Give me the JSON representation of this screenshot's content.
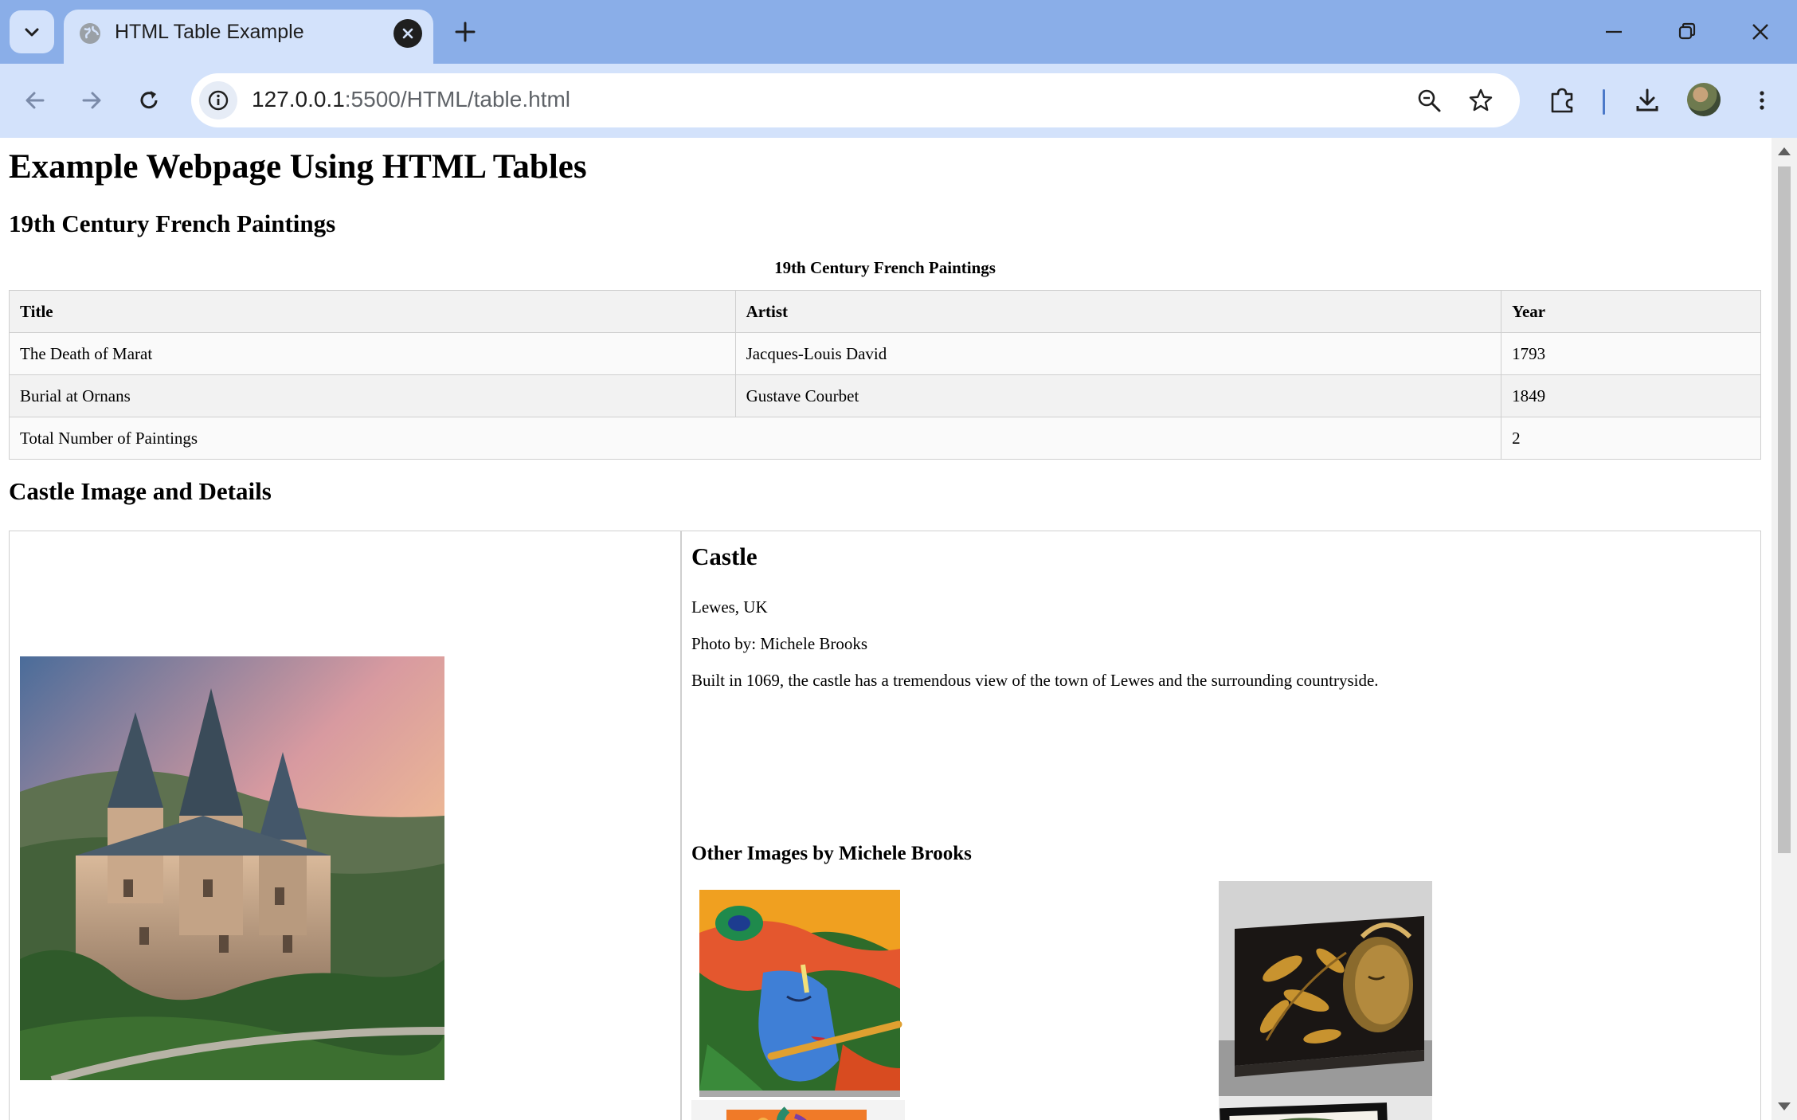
{
  "browser": {
    "tab_title": "HTML Table Example",
    "url_host": "127.0.0.1",
    "url_rest": ":5500/HTML/table.html",
    "accent": "#8aaee8"
  },
  "page": {
    "heading": "Example Webpage Using HTML Tables",
    "section1_heading": "19th Century French Paintings",
    "table_caption": "19th Century French Paintings",
    "table_headers": [
      "Title",
      "Artist",
      "Year"
    ],
    "table_rows": [
      {
        "title": "The Death of Marat",
        "artist": "Jacques-Louis David",
        "year": "1793"
      },
      {
        "title": "Burial at Ornans",
        "artist": "Gustave Courbet",
        "year": "1849"
      }
    ],
    "total_label": "Total Number of Paintings",
    "total_value": "2",
    "section2_heading": "Castle Image and Details",
    "castle": {
      "title": "Castle",
      "location": "Lewes, UK",
      "photo_by": "Photo by: Michele Brooks",
      "description": "Built in 1069, the castle has a tremendous view of the town of Lewes and the surrounding countryside.",
      "other_heading": "Other Images by Michele Brooks"
    }
  }
}
